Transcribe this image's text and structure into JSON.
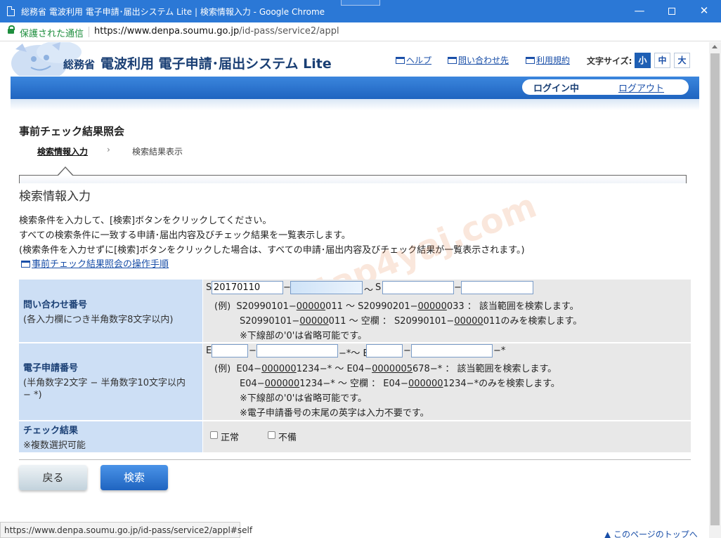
{
  "window": {
    "title": "総務省 電波利用 電子申請･届出システム Lite | 検索情報入力 - Google Chrome",
    "minimize_glyph": "—",
    "close_glyph": "✕"
  },
  "address": {
    "secure_label": "保護された通信",
    "url_host": "https://www.denpa.soumu.go.jp",
    "url_path": "/id-pass/service2/appl"
  },
  "header": {
    "ministry": "総務省",
    "system_name": "電波利用 電子申請･届出システム Lite",
    "links": {
      "help": "ヘルプ",
      "contact": "問い合わせ先",
      "terms": "利用規約"
    },
    "font_size_label": "文字サイズ:",
    "font_sizes": [
      "小",
      "中",
      "大"
    ],
    "login_status": "ログイン中",
    "logout": "ログアウト"
  },
  "page": {
    "heading": "事前チェック結果照会",
    "breadcrumb": {
      "current": "検索情報入力",
      "arrow": "›",
      "next": "検索結果表示"
    },
    "section_title": "検索情報入力",
    "description": [
      "検索条件を入力して、[検索]ボタンをクリックしてください。",
      "すべての検索条件に一致する申請･届出内容及びチェック結果を一覧表示します。",
      "(検索条件を入力せずに[検索]ボタンをクリックした場合は、すべての申請･届出内容及びチェック結果が一覧表示されます。)"
    ],
    "manual_link": "事前チェック結果照会の操作手順",
    "watermark": "tap4yaj.com"
  },
  "form": {
    "inquiry": {
      "label": "問い合わせ番号",
      "sublabel": "(各入力欄につき半角数字8文字以内)",
      "prefix": "S",
      "dash": "−",
      "tilde": "〜",
      "from_value": "20170110",
      "example_label": "(例)",
      "ex1_a": "S20990101−",
      "ex1_b": "00000",
      "ex1_c": "011 〜 S20990201−",
      "ex1_d": "00000",
      "ex1_e": "033 ： 該当範囲を検索します。",
      "ex2_a": "S20990101−",
      "ex2_b": "00000",
      "ex2_c": "011 〜 空欄 ： S20990101−",
      "ex2_d": "00000",
      "ex2_e": "011のみを検索します。",
      "note": "※下線部の'0'は省略可能です。"
    },
    "epermit": {
      "label": "電子申請番号",
      "sublabel1": "(半角数字2文字 − 半角数字10文字以内",
      "sublabel2": "− *)",
      "prefix": "E",
      "dash": "−",
      "suffix": "−*",
      "tilde": "−*〜 E",
      "example_label": "(例)",
      "ex1_a": "E04−",
      "ex1_b": "000000",
      "ex1_c": "1234−* 〜 E04−",
      "ex1_d": "0000005",
      "ex1_e": "678−* ： 該当範囲を検索します。",
      "ex2_a": "E04−",
      "ex2_b": "000000",
      "ex2_c": "1234−* 〜 空欄 ： E04−",
      "ex2_d": "000000",
      "ex2_e": "1234−*のみを検索します。",
      "note1": "※下線部の'0'は省略可能です。",
      "note2": "※電子申請番号の末尾の英字は入力不要です。"
    },
    "check": {
      "label": "チェック結果",
      "sublabel": "※複数選択可能",
      "opt_normal": "正常",
      "opt_defect": "不備"
    }
  },
  "buttons": {
    "back": "戻る",
    "search": "検索"
  },
  "status_url": "https://www.denpa.soumu.go.jp/id-pass/service2/appl#self",
  "page_top": "▲ このページのトップへ",
  "colors": {
    "titlebar": "#2b78d6",
    "brand_blue": "#1f64c0",
    "label_bg": "#cddff5",
    "value_bg": "#e8e8e8",
    "link": "#1a4fa8"
  }
}
